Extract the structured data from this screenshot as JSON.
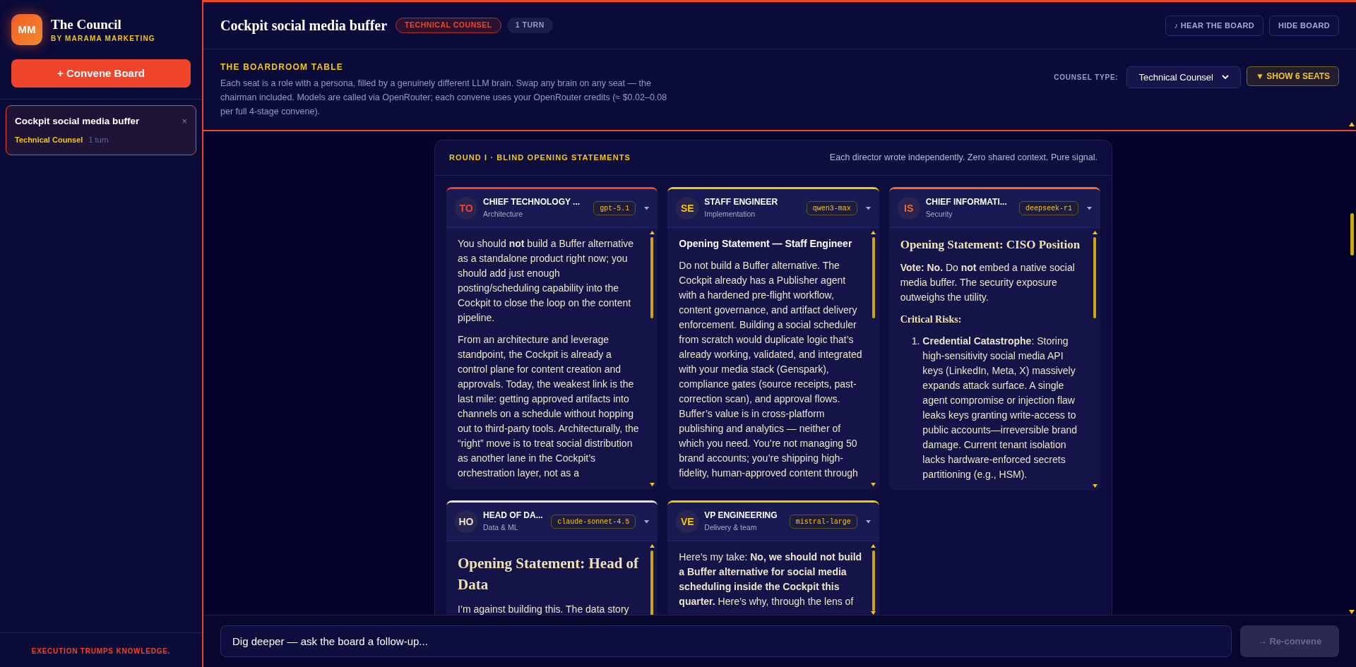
{
  "sidebar": {
    "logo": "MM",
    "app_title": "The Council",
    "subtitle": "BY MARAMA MARKETING",
    "convene_button": "+ Convene Board",
    "sessions": [
      {
        "title": "Cockpit social media buffer",
        "counsel": "Technical Counsel",
        "turns": "1 turn",
        "close": "×",
        "selected": true
      }
    ],
    "footer": "EXECUTION TRUMPS KNOWLEDGE."
  },
  "header": {
    "title": "Cockpit social media buffer",
    "badges": [
      {
        "text": "TECHNICAL COUNSEL",
        "kind": "accent"
      },
      {
        "text": "1 TURN",
        "kind": "muted"
      }
    ],
    "buttons": [
      "♪ HEAR THE BOARD",
      "HIDE BOARD"
    ]
  },
  "boardroom": {
    "heading": "THE BOARDROOM TABLE",
    "description": "Each seat is a role with a persona, filled by a genuinely different LLM brain. Swap any brain on any seat — the chairman included. Models are called via OpenRouter; each convene uses your OpenRouter credits (≈ $0.02–0.08 per full 4-stage convene).",
    "counsel_type_label": "COUNSEL TYPE:",
    "counsel_type_value": "Technical Counsel",
    "seats_button": "▼ SHOW 6 SEATS"
  },
  "round": {
    "title": "ROUND I · BLIND OPENING STATEMENTS",
    "note": "Each director wrote independently. Zero shared context. Pure signal.",
    "seats": [
      {
        "initials": "TO",
        "title": "CHIEF TECHNOLOGY ...",
        "subtitle": "Architecture",
        "model": "gpt-5.1",
        "color": "#f0452a",
        "blocks": [
          {
            "kind": "paragraph",
            "text": "You should **not** build a Buffer alternative as a standalone product right now; you should add just enough posting/scheduling capability into the Cockpit to close the loop on the content pipeline."
          },
          {
            "kind": "paragraph",
            "text": "From an architecture and leverage standpoint, the Cockpit is already a control plane for content creation and approvals. Today, the weakest link is the last mile: getting approved artifacts into channels on a schedule without hopping out to third-party tools. Architecturally, the “right” move is to treat social distribution as another lane in the Cockpit’s orchestration layer, not as a"
          }
        ]
      },
      {
        "initials": "SE",
        "title": "STAFF ENGINEER",
        "subtitle": "Implementation",
        "model": "qwen3-max",
        "color": "#f5c518",
        "blocks": [
          {
            "kind": "heading",
            "text": "Opening Statement — Staff Engineer"
          },
          {
            "kind": "paragraph",
            "text": "Do not build a Buffer alternative. The Cockpit already has a Publisher agent with a hardened pre-flight workflow, content governance, and artifact delivery enforcement. Building a social scheduler from scratch would duplicate logic that’s already working, validated, and integrated with your media stack (Genspark), compliance gates (source receipts, past-correction scan), and approval flows. Buffer’s value is in cross-platform publishing and analytics — neither of which you need. You’re not managing 50 brand accounts; you’re shipping high-fidelity, human-approved content through"
          }
        ]
      },
      {
        "initials": "IS",
        "title": "CHIEF INFORMATI...",
        "subtitle": "Security",
        "model": "deepseek-r1",
        "color": "#f26a2e",
        "blocks": [
          {
            "kind": "subtitle",
            "text": "Opening Statement: CISO Position"
          },
          {
            "kind": "paragraph",
            "text": "**Vote: No.** Do **not** embed a native social media buffer. The security exposure outweighs the utility."
          },
          {
            "kind": "subheading",
            "text": "Critical Risks:"
          },
          {
            "kind": "list",
            "items": [
              {
                "number": "1.",
                "text": "**Credential Catastrophe**: Storing high-sensitivity social media API keys (LinkedIn, Meta, X) massively expands attack surface. A single agent compromise or injection flaw leaks keys granting write-access to public accounts—irreversible brand damage. Current tenant isolation lacks hardware-enforced secrets partitioning (e.g., HSM)."
              }
            ]
          }
        ]
      },
      {
        "initials": "HO",
        "title": "HEAD OF DA...",
        "subtitle": "Data & ML",
        "model": "claude-sonnet-4.5",
        "color": "#ece3cf",
        "blocks": [
          {
            "kind": "title",
            "text": "Opening Statement: Head of Data"
          },
          {
            "kind": "paragraph",
            "text": "I’m against building this. The data story"
          }
        ]
      },
      {
        "initials": "VE",
        "title": "VP ENGINEERING",
        "subtitle": "Delivery & team",
        "model": "mistral-large",
        "color": "#f5c518",
        "blocks": [
          {
            "kind": "paragraph",
            "text": "Here’s my take: **No, we should not build a Buffer alternative for social media scheduling inside the Cockpit this quarter.** Here’s why, through the lens of"
          }
        ]
      }
    ]
  },
  "composer": {
    "placeholder": "Dig deeper — ask the board a follow-up...",
    "button": "→ Re-convene",
    "disabled": true
  }
}
